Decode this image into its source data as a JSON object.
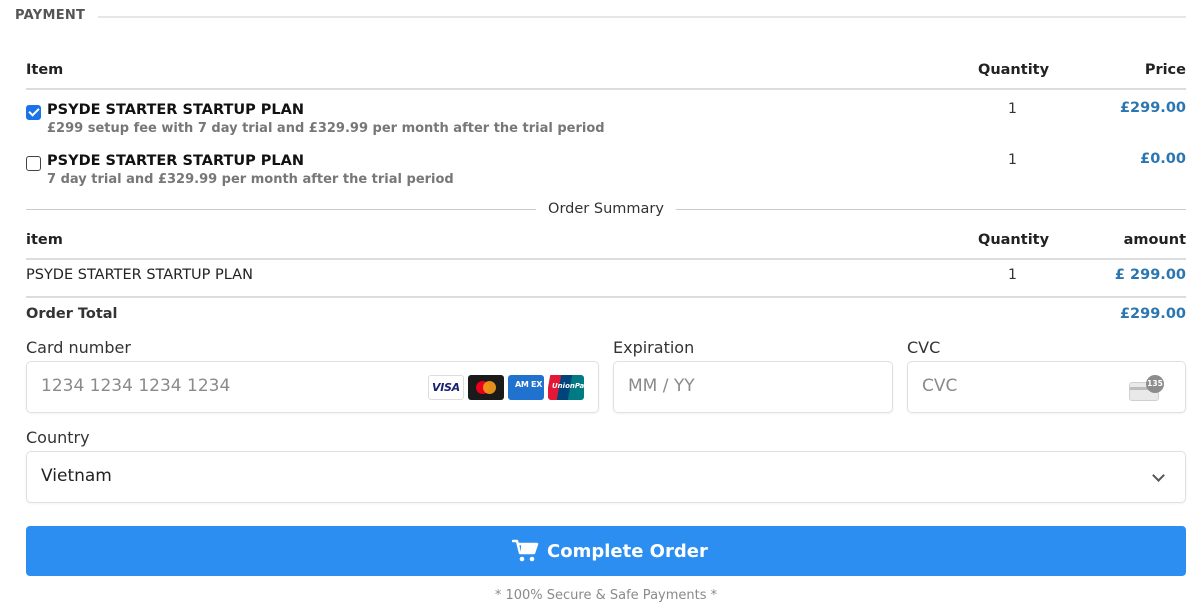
{
  "section": {
    "title": "PAYMENT"
  },
  "items_table": {
    "headers": {
      "item": "Item",
      "quantity": "Quantity",
      "price": "Price"
    },
    "rows": [
      {
        "name": "PSYDE STARTER STARTUP PLAN",
        "description": "£299 setup fee with 7 day trial and £329.99 per month after the trial period",
        "quantity": "1",
        "price": "£299.00",
        "checked": true
      },
      {
        "name": "PSYDE STARTER STARTUP PLAN",
        "description": "7 day trial and £329.99 per month after the trial period",
        "quantity": "1",
        "price": "£0.00",
        "checked": false
      }
    ]
  },
  "order_summary": {
    "label": "Order Summary",
    "headers": {
      "item": "item",
      "quantity": "Quantity",
      "amount": "amount"
    },
    "rows": [
      {
        "name": "PSYDE STARTER STARTUP PLAN",
        "quantity": "1",
        "amount": "£ 299.00"
      }
    ],
    "total_label": "Order Total",
    "total_amount": "£299.00"
  },
  "card_form": {
    "card_number_label": "Card number",
    "card_number_placeholder": "1234 1234 1234 1234",
    "expiration_label": "Expiration",
    "expiration_placeholder": "MM / YY",
    "cvc_label": "CVC",
    "cvc_placeholder": "CVC",
    "cvc_badge": "135",
    "card_brands": {
      "visa": "VISA",
      "amex": "AM EX",
      "unionpay": "UnionPay"
    },
    "icons": [
      "visa-icon",
      "mastercard-icon",
      "amex-icon",
      "unionpay-icon",
      "cvc-card-icon"
    ]
  },
  "country": {
    "label": "Country",
    "value": "Vietnam"
  },
  "submit": {
    "label": "Complete Order",
    "icon": "cart-icon"
  },
  "footer": {
    "secure_note": "* 100% Secure & Safe Payments *"
  },
  "colors": {
    "accent": "#2b8ef0",
    "price": "#2b76b0",
    "checkbox": "#1a73e8"
  }
}
